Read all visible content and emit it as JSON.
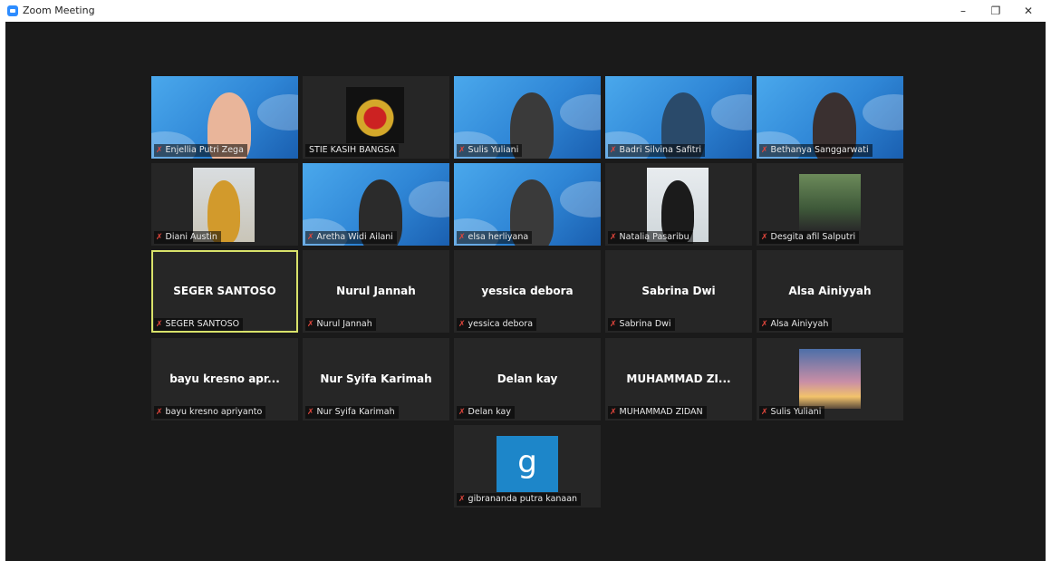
{
  "window": {
    "title": "Zoom Meeting",
    "minimize": "–",
    "restore": "❐",
    "close": "✕"
  },
  "colors": {
    "stage_bg": "#1a1a1a",
    "tile_bg": "#262626",
    "active_speaker_border": "#d8e26a",
    "muted_icon": "#e0463c",
    "avatar_letter_bg": "#1d86c9"
  },
  "participants": [
    {
      "label": "Enjellia Putri Zega",
      "muted": true,
      "video": "slide"
    },
    {
      "label": "STIE KASIH BANGSA",
      "muted": false,
      "video": "logo"
    },
    {
      "label": "Sulis Yuliani",
      "muted": true,
      "video": "slide"
    },
    {
      "label": "Badri Silvina Safitri",
      "muted": true,
      "video": "slide"
    },
    {
      "label": "Bethanya Sanggarwati",
      "muted": true,
      "video": "slide"
    },
    {
      "label": "Diani Austin",
      "muted": true,
      "video": "camera"
    },
    {
      "label": "Aretha Widi Ailani",
      "muted": true,
      "video": "slide"
    },
    {
      "label": "elsa herliyana",
      "muted": true,
      "video": "slide"
    },
    {
      "label": "Natalia Pasaribu",
      "muted": true,
      "video": "camera"
    },
    {
      "label": "Desgita afil Salputri",
      "muted": true,
      "video": "photo"
    },
    {
      "label": "SEGER SANTOSO",
      "big": "SEGER SANTOSO",
      "muted": true,
      "video": "off",
      "active": true
    },
    {
      "label": "Nurul Jannah",
      "big": "Nurul Jannah",
      "muted": true,
      "video": "off"
    },
    {
      "label": "yessica debora",
      "big": "yessica debora",
      "muted": true,
      "video": "off"
    },
    {
      "label": "Sabrina Dwi",
      "big": "Sabrina Dwi",
      "muted": true,
      "video": "off"
    },
    {
      "label": "Alsa Ainiyyah",
      "big": "Alsa Ainiyyah",
      "muted": true,
      "video": "off"
    },
    {
      "label": "bayu kresno apriyanto",
      "big": "bayu kresno apr...",
      "muted": true,
      "video": "off"
    },
    {
      "label": "Nur Syifa Karimah",
      "big": "Nur Syifa Karimah",
      "muted": true,
      "video": "off"
    },
    {
      "label": "Delan kay",
      "big": "Delan kay",
      "muted": true,
      "video": "off"
    },
    {
      "label": "MUHAMMAD ZIDAN",
      "big": "MUHAMMAD ZI...",
      "muted": true,
      "video": "off"
    },
    {
      "label": "Sulis Yuliani",
      "muted": true,
      "video": "sunset"
    },
    {
      "label": "gibrananda putra kanaan",
      "muted": true,
      "video": "avatar",
      "avatar_letter": "g"
    }
  ],
  "icons": {
    "muted": "muted-mic-icon",
    "app": "zoom-app-icon"
  }
}
